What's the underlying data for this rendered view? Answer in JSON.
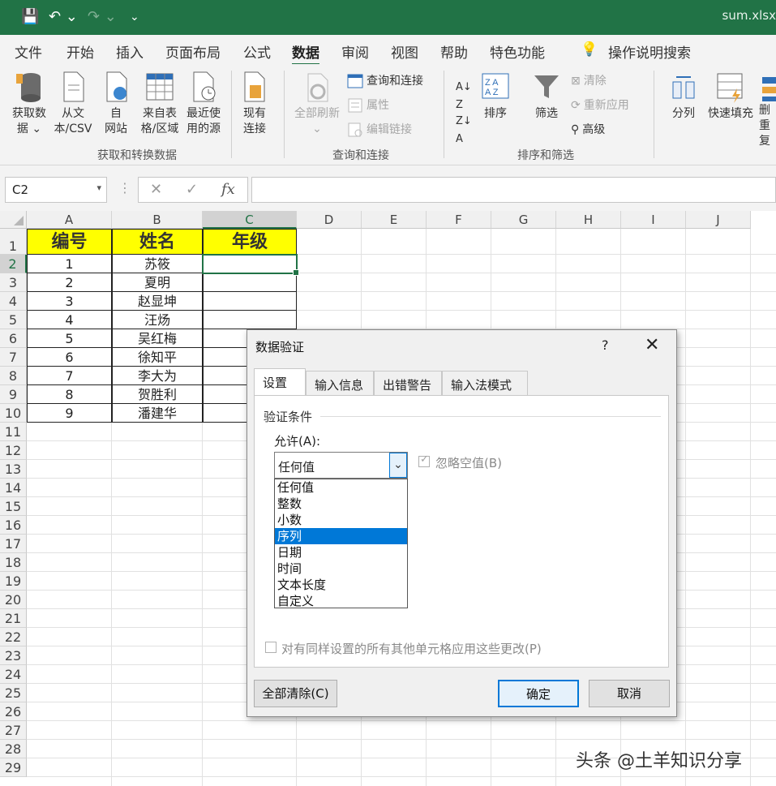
{
  "window": {
    "file_name": "sum.xlsx"
  },
  "menu": {
    "tabs": [
      "文件",
      "开始",
      "插入",
      "页面布局",
      "公式",
      "数据",
      "审阅",
      "视图",
      "帮助",
      "特色功能"
    ],
    "active_tab": "数据",
    "search_label": "操作说明搜索"
  },
  "ribbon": {
    "get_data": {
      "line1": "获取数",
      "line2": "据 ⌄"
    },
    "from_csv": {
      "line1": "从文",
      "line2": "本/CSV"
    },
    "from_web": {
      "line1": "自",
      "line2": "网站"
    },
    "from_table": {
      "line1": "来自表",
      "line2": "格/区域"
    },
    "recent_sources": {
      "line1": "最近使",
      "line2": "用的源"
    },
    "existing_conn": {
      "line1": "现有",
      "line2": "连接"
    },
    "refresh_all": {
      "line1": "全部刷新",
      "line2": "⌄"
    },
    "queries_conn": "查询和连接",
    "properties": "属性",
    "edit_links": "编辑链接",
    "sort": "排序",
    "filter": "筛选",
    "clear": "清除",
    "reapply": "重新应用",
    "advanced": "高级",
    "text_to_columns": "分列",
    "flash_fill": "快速填充",
    "remove_dup": {
      "line1": "删",
      "line2": "重复"
    },
    "groups": {
      "get_transform": "获取和转换数据",
      "queries": "查询和连接",
      "sort_filter": "排序和筛选"
    }
  },
  "formula_bar": {
    "name_box": "C2",
    "cancel": "✕",
    "enter": "✓",
    "fx": "fx",
    "value": ""
  },
  "sheet": {
    "columns": [
      "A",
      "B",
      "C",
      "D",
      "E",
      "F",
      "G",
      "H",
      "I",
      "J"
    ],
    "rows": [
      "1",
      "2",
      "3",
      "4",
      "5",
      "6",
      "7",
      "8",
      "9",
      "10",
      "11",
      "12",
      "13",
      "14",
      "15",
      "16",
      "17",
      "18",
      "19",
      "20",
      "21",
      "22",
      "23",
      "24",
      "25",
      "26",
      "27",
      "28",
      "29"
    ],
    "header": [
      "编号",
      "姓名",
      "年级"
    ],
    "data": [
      [
        "1",
        "苏筱",
        ""
      ],
      [
        "2",
        "夏明",
        ""
      ],
      [
        "3",
        "赵显坤",
        ""
      ],
      [
        "4",
        "汪炀",
        ""
      ],
      [
        "5",
        "吴红梅",
        ""
      ],
      [
        "6",
        "徐知平",
        ""
      ],
      [
        "7",
        "李大为",
        ""
      ],
      [
        "8",
        "贺胜利",
        ""
      ],
      [
        "9",
        "潘建华",
        ""
      ]
    ],
    "header_fill": "#ffff00",
    "accent": "#217346"
  },
  "dialog": {
    "title": "数据验证",
    "help": "?",
    "close": "✕",
    "tabs": [
      "设置",
      "输入信息",
      "出错警告",
      "输入法模式"
    ],
    "active_tab": "设置",
    "section": "验证条件",
    "allow_label": "允许(A):",
    "allow_value": "任何值",
    "options": [
      "任何值",
      "整数",
      "小数",
      "序列",
      "日期",
      "时间",
      "文本长度",
      "自定义"
    ],
    "highlighted_option": "序列",
    "ignore_blank": {
      "label": "忽略空值(B)",
      "checked": true
    },
    "apply_all": {
      "label": "对有同样设置的所有其他单元格应用这些更改(P)",
      "checked": false
    },
    "clear_all": "全部清除(C)",
    "ok": "确定",
    "cancel": "取消",
    "select_color": "#0078d7"
  },
  "watermark": "头条 @土羊知识分享"
}
